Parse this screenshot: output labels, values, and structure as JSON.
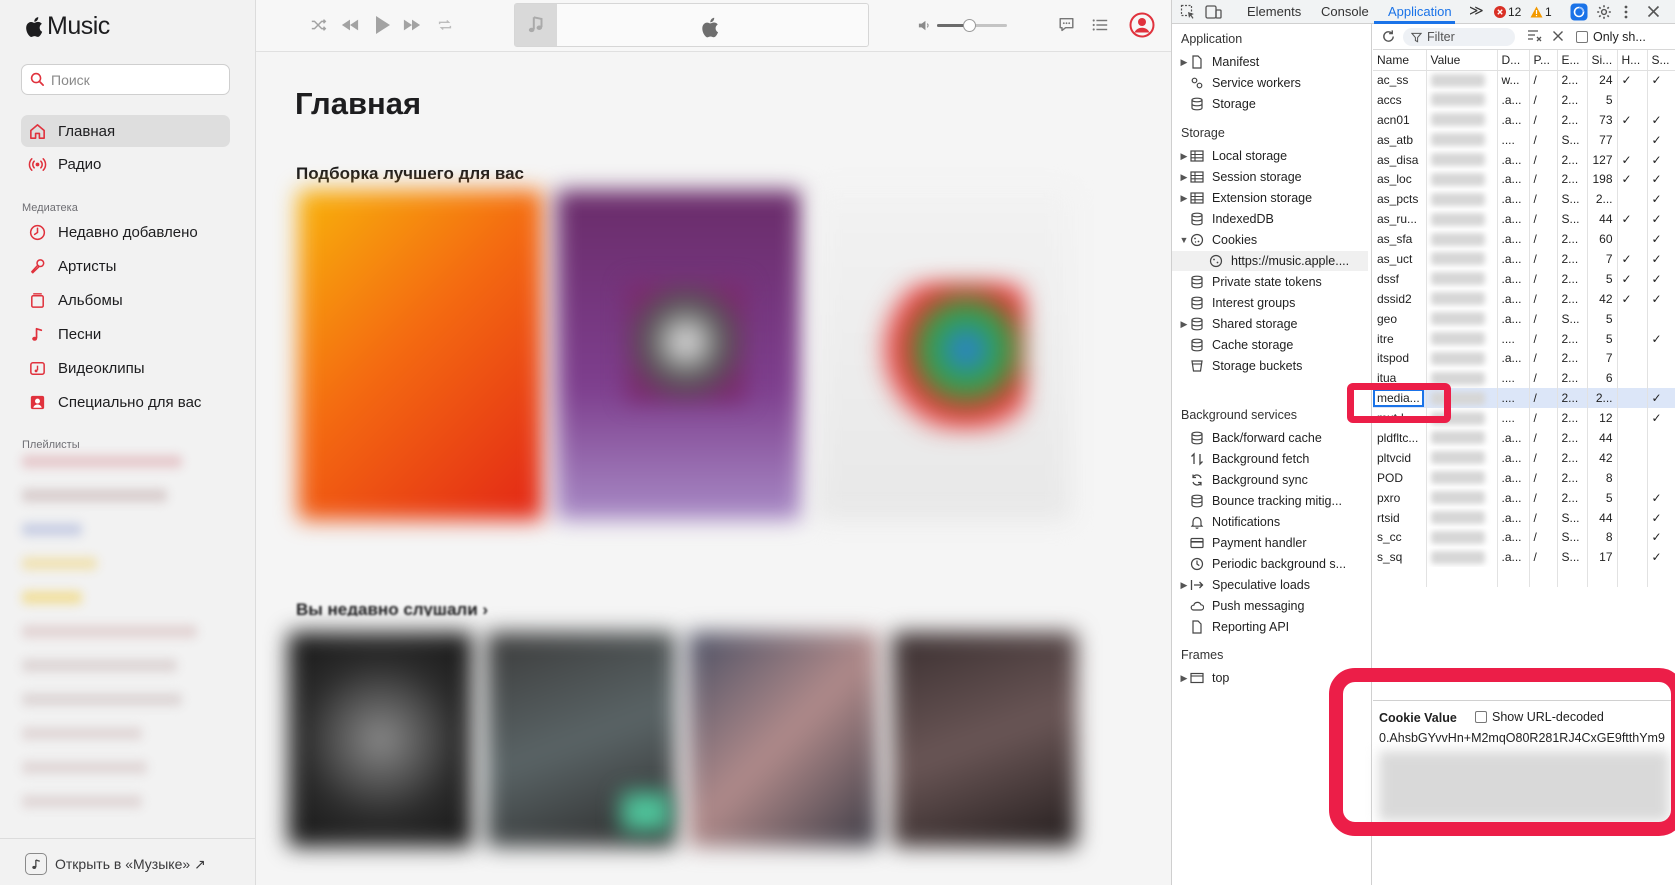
{
  "app": {
    "brand": "Music",
    "search_placeholder": "Поиск"
  },
  "sidebar": {
    "nav": [
      {
        "label": "Главная",
        "icon": "home-icon",
        "active": true
      },
      {
        "label": "Радио",
        "icon": "radio-icon",
        "active": false
      }
    ],
    "library_label": "Медиатека",
    "library": [
      {
        "label": "Недавно добавлено",
        "icon": "clock-icon"
      },
      {
        "label": "Артисты",
        "icon": "microphone-icon"
      },
      {
        "label": "Альбомы",
        "icon": "album-icon"
      },
      {
        "label": "Песни",
        "icon": "note-icon"
      },
      {
        "label": "Видеоклипы",
        "icon": "video-icon"
      },
      {
        "label": "Специально для вас",
        "icon": "person-icon"
      }
    ],
    "playlists_label": "Плейлисты",
    "open_in_music": "Открыть в «Музыке» ↗"
  },
  "player": {
    "volume": 0.45
  },
  "main": {
    "title": "Главная",
    "section_top_picks": "Подборка лучшего для вас",
    "section_recent": "Вы недавно слушали ›"
  },
  "devtools": {
    "tabs": [
      "Elements",
      "Console",
      "Application"
    ],
    "active_tab": "Application",
    "more_tabs": "≫",
    "errors": "12",
    "warnings": "1",
    "colors": {
      "accent": "#1a73e8",
      "error": "#d93025",
      "warning": "#f29900",
      "annotation": "#ec1e48"
    },
    "tree": {
      "application_header": "Application",
      "application": [
        "Manifest",
        "Service workers",
        "Storage"
      ],
      "storage_header": "Storage",
      "storage": [
        "Local storage",
        "Session storage",
        "Extension storage",
        "IndexedDB",
        "Cookies"
      ],
      "cookie_origin": "https://music.apple....",
      "storage_more": [
        "Private state tokens",
        "Interest groups",
        "Shared storage",
        "Cache storage",
        "Storage buckets"
      ],
      "background_header": "Background services",
      "background": [
        "Back/forward cache",
        "Background fetch",
        "Background sync",
        "Bounce tracking mitig...",
        "Notifications",
        "Payment handler",
        "Periodic background s...",
        "Speculative loads",
        "Push messaging",
        "Reporting API"
      ],
      "frames_header": "Frames",
      "frames": [
        "top"
      ]
    },
    "cookies": {
      "filter_placeholder": "Filter",
      "only_show": "Only sh...",
      "columns": [
        "Name",
        "Value",
        "D...",
        "P...",
        "E...",
        "Si...",
        "H...",
        "S..."
      ],
      "rows": [
        {
          "name": "ac_ss",
          "d": "w...",
          "p": "/",
          "e": "2...",
          "size": "24",
          "h": "✓",
          "s": "✓"
        },
        {
          "name": "accs",
          "d": ".a...",
          "p": "/",
          "e": "2...",
          "size": "5",
          "h": "",
          "s": ""
        },
        {
          "name": "acn01",
          "d": ".a...",
          "p": "/",
          "e": "2...",
          "size": "73",
          "h": "✓",
          "s": "✓"
        },
        {
          "name": "as_atb",
          "d": "....",
          "p": "/",
          "e": "S...",
          "size": "77",
          "h": "",
          "s": "✓"
        },
        {
          "name": "as_disa",
          "d": ".a...",
          "p": "/",
          "e": "2...",
          "size": "127",
          "h": "✓",
          "s": "✓"
        },
        {
          "name": "as_loc",
          "d": ".a...",
          "p": "/",
          "e": "2...",
          "size": "198",
          "h": "✓",
          "s": "✓"
        },
        {
          "name": "as_pcts",
          "d": ".a...",
          "p": "/",
          "e": "S...",
          "size": "2...",
          "h": "",
          "s": "✓"
        },
        {
          "name": "as_ru...",
          "d": ".a...",
          "p": "/",
          "e": "S...",
          "size": "44",
          "h": "✓",
          "s": "✓"
        },
        {
          "name": "as_sfa",
          "d": ".a...",
          "p": "/",
          "e": "2...",
          "size": "60",
          "h": "",
          "s": "✓"
        },
        {
          "name": "as_uct",
          "d": ".a...",
          "p": "/",
          "e": "2...",
          "size": "7",
          "h": "✓",
          "s": "✓"
        },
        {
          "name": "dssf",
          "d": ".a...",
          "p": "/",
          "e": "2...",
          "size": "5",
          "h": "✓",
          "s": "✓"
        },
        {
          "name": "dssid2",
          "d": ".a...",
          "p": "/",
          "e": "2...",
          "size": "42",
          "h": "✓",
          "s": "✓"
        },
        {
          "name": "geo",
          "d": ".a...",
          "p": "/",
          "e": "S...",
          "size": "5",
          "h": "",
          "s": ""
        },
        {
          "name": "itre",
          "d": "....",
          "p": "/",
          "e": "2...",
          "size": "5",
          "h": "",
          "s": "✓"
        },
        {
          "name": "itspod",
          "d": ".a...",
          "p": "/",
          "e": "2...",
          "size": "7",
          "h": "",
          "s": ""
        },
        {
          "name": "itua",
          "d": "....",
          "p": "/",
          "e": "2...",
          "size": "6",
          "h": "",
          "s": ""
        },
        {
          "name": "media...",
          "d": "....",
          "p": "/",
          "e": "2...",
          "size": "2...",
          "h": "",
          "s": "✓",
          "selected": true
        },
        {
          "name": "mut-l...",
          "d": "....",
          "p": "/",
          "e": "2...",
          "size": "12",
          "h": "",
          "s": "✓"
        },
        {
          "name": "pldfltc...",
          "d": ".a...",
          "p": "/",
          "e": "2...",
          "size": "44",
          "h": "",
          "s": ""
        },
        {
          "name": "pltvcid",
          "d": ".a...",
          "p": "/",
          "e": "2...",
          "size": "42",
          "h": "",
          "s": ""
        },
        {
          "name": "POD",
          "d": ".a...",
          "p": "/",
          "e": "2...",
          "size": "8",
          "h": "",
          "s": ""
        },
        {
          "name": "pxro",
          "d": ".a...",
          "p": "/",
          "e": "2...",
          "size": "5",
          "h": "",
          "s": "✓"
        },
        {
          "name": "rtsid",
          "d": ".a...",
          "p": "/",
          "e": "S...",
          "size": "44",
          "h": "",
          "s": "✓"
        },
        {
          "name": "s_cc",
          "d": ".a...",
          "p": "/",
          "e": "S...",
          "size": "8",
          "h": "",
          "s": "✓"
        },
        {
          "name": "s_sq",
          "d": ".a...",
          "p": "/",
          "e": "S...",
          "size": "17",
          "h": "",
          "s": "✓"
        }
      ]
    },
    "cookie_value": {
      "title": "Cookie Value",
      "decode_label": "Show URL-decoded",
      "value": "0.AhsbGYvvHn+M2mqO80R281RJ4CxGE9ftthYm9"
    }
  }
}
